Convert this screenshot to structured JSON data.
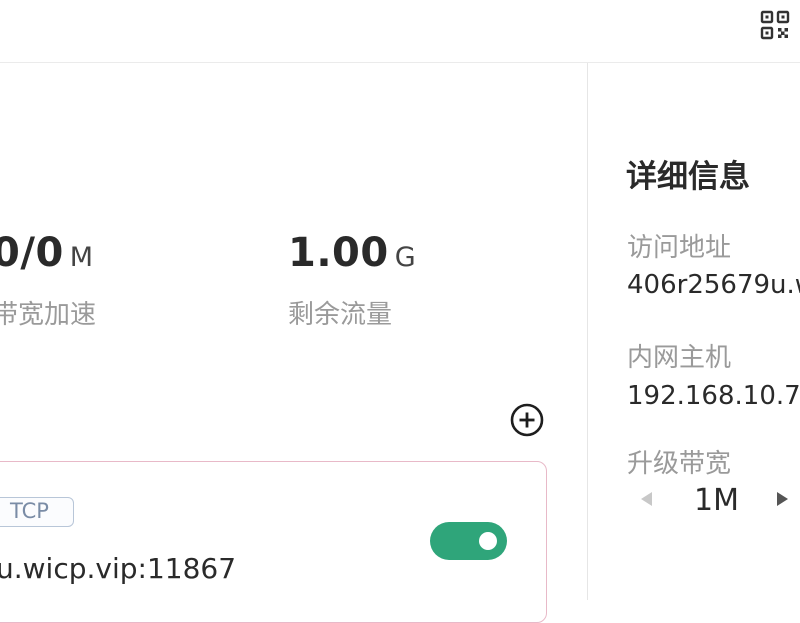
{
  "header": {
    "qr_icon": "qr-code-icon"
  },
  "stats": [
    {
      "value": "0/0",
      "unit": "M",
      "label": "带宽加速"
    },
    {
      "value": "1.00",
      "unit": "G",
      "label": "剩余流量"
    }
  ],
  "mappings": {
    "add_icon": "plus-circle-icon",
    "items": [
      {
        "protocol": "TCP",
        "address": "u.wicp.vip:11867",
        "enabled": true
      }
    ]
  },
  "details": {
    "title": "详细信息",
    "access_label": "访问地址",
    "access_value": "406r25679u.w",
    "host_label": "内网主机",
    "host_value": "192.168.10.7",
    "upgrade_label": "升级带宽",
    "bandwidth_value": "1M"
  },
  "colors": {
    "toggle_on": "#2fa57a",
    "card_border": "#e8b9c8",
    "tag_border": "#b8c6d8"
  }
}
